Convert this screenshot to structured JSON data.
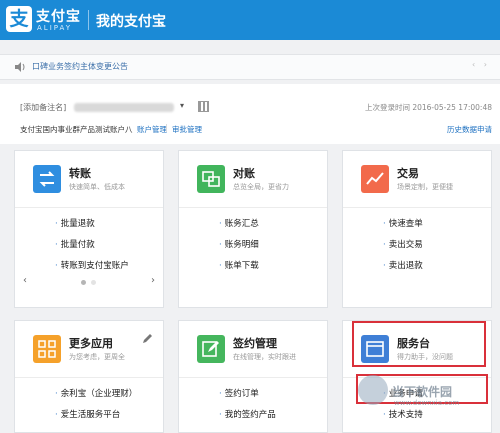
{
  "header": {
    "logo_mark": "支",
    "logo_cn": "支付宝",
    "logo_en": "ALIPAY",
    "title": "我的支付宝"
  },
  "notice": {
    "text": "口碑业务签约主体变更公告",
    "arrows": "‹ ›"
  },
  "account": {
    "remark": "[添加备注名]",
    "dropdown_caret": "▾",
    "last_login": "上次登录时间 2016-05-25 17:00:48",
    "name": "支付宝国内事业群产品测试账户八",
    "links": [
      "账户管理",
      "审批管理"
    ],
    "history": "历史数据申请"
  },
  "cards": {
    "transfer": {
      "title": "转账",
      "subtitle": "快速简单、低成本",
      "links": [
        "批量退款",
        "批量付款",
        "转账到支付宝账户"
      ],
      "color": "#2f8ee0"
    },
    "reconcile": {
      "title": "对账",
      "subtitle": "总览全局，更省力",
      "links": [
        "账务汇总",
        "账务明细",
        "账单下载"
      ],
      "color": "#41b55c"
    },
    "trade": {
      "title": "交易",
      "subtitle": "场景定制，更便捷",
      "links": [
        "快速查单",
        "卖出交易",
        "卖出退款"
      ],
      "color": "#f26a4b"
    },
    "more_apps": {
      "title": "更多应用",
      "subtitle": "为您考虑，更周全",
      "links": [
        "余利宝（企业理财）",
        "爱生活服务平台"
      ],
      "color": "#f5a12a"
    },
    "contract": {
      "title": "签约管理",
      "subtitle": "在线管理，实时跟进",
      "links": [
        "签约订单",
        "我的签约产品"
      ],
      "color": "#45b65d"
    },
    "service": {
      "title": "服务台",
      "subtitle": "得力助手，没问题",
      "links": [
        "业务申请",
        "技术支持"
      ],
      "color": "#3f7fd6"
    }
  },
  "pager": {
    "prev": "‹",
    "next": "›"
  },
  "watermark": {
    "text": "当下软件园",
    "url": "www.downxia.com"
  }
}
